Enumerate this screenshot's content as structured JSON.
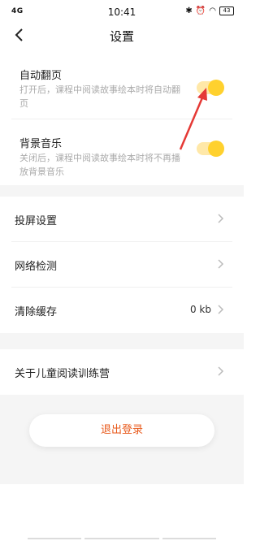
{
  "status_bar": {
    "network": "4G",
    "time": "10:41",
    "battery": "43"
  },
  "nav": {
    "title": "设置"
  },
  "toggles": [
    {
      "label": "自动翻页",
      "description": "打开后，课程中阅读故事绘本时将自动翻页",
      "enabled": true
    },
    {
      "label": "背景音乐",
      "description": "关闭后，课程中阅读故事绘本时将不再播放背景音乐",
      "enabled": true
    }
  ],
  "menu": {
    "screen_cast": "投屏设置",
    "network_check": "网络检测",
    "clear_cache": "清除缓存",
    "cache_size": "0 kb",
    "about": "关于儿童阅读训练营"
  },
  "logout_label": "退出登录",
  "colors": {
    "toggle_knob": "#ffd12e",
    "toggle_track": "#ffe8a8",
    "logout_text": "#e85a1c",
    "annotation_arrow": "#e53935",
    "section_gap": "#f5f5f5"
  }
}
